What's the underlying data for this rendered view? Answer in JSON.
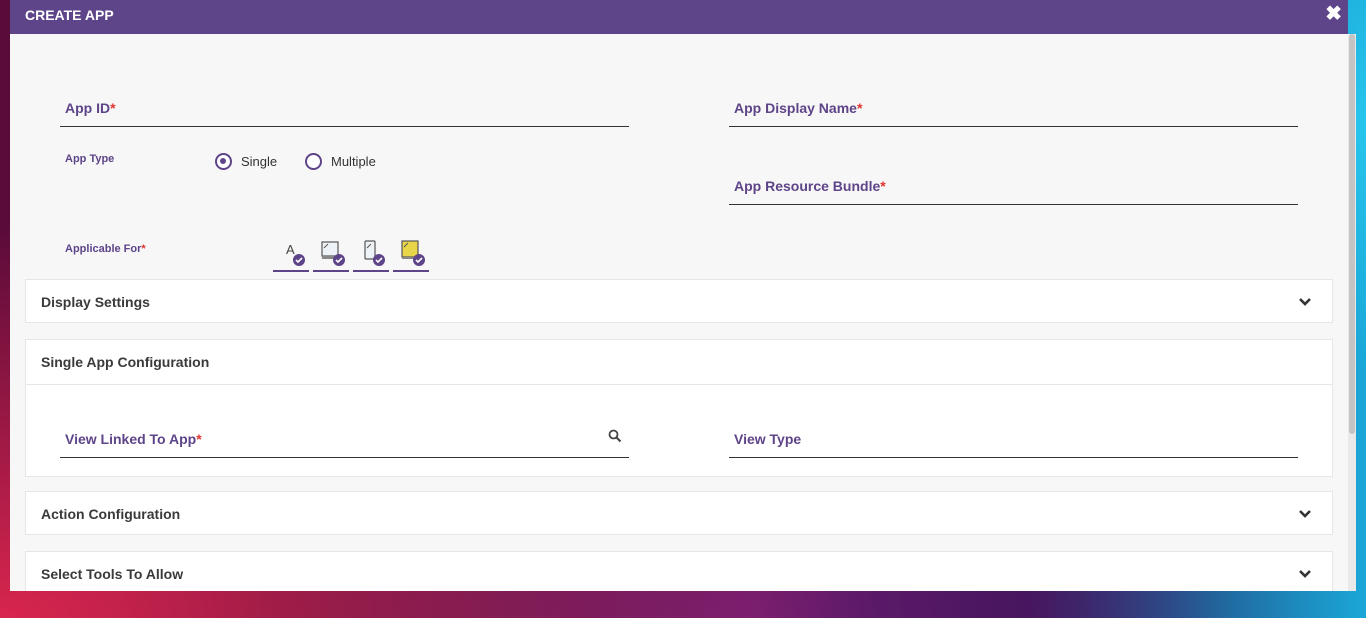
{
  "dialog": {
    "title": "CREATE APP",
    "close_icon": "close-icon"
  },
  "fields": {
    "app_id": {
      "label": "App ID",
      "required": "*",
      "value": ""
    },
    "app_display_name": {
      "label": "App Display Name",
      "required": "*",
      "value": ""
    },
    "app_resource_bundle": {
      "label": "App Resource Bundle",
      "required": "*",
      "value": ""
    }
  },
  "app_type": {
    "label": "App Type",
    "options": [
      {
        "label": "Single",
        "selected": true
      },
      {
        "label": "Multiple",
        "selected": false
      }
    ]
  },
  "applicable_for": {
    "label": "Applicable For",
    "required": "*",
    "devices": [
      {
        "icon": "accessibility-text-icon",
        "checked": true
      },
      {
        "icon": "desktop-icon",
        "checked": true
      },
      {
        "icon": "mobile-icon",
        "checked": true
      },
      {
        "icon": "tablet-icon",
        "checked": true
      }
    ]
  },
  "sections": {
    "display_settings": {
      "title": "Display Settings"
    },
    "single_app_configuration": {
      "title": "Single App Configuration",
      "view_linked_to_app": {
        "label": "View Linked To App",
        "required": "*",
        "value": ""
      },
      "view_type": {
        "label": "View Type",
        "value": ""
      }
    },
    "action_configuration": {
      "title": "Action Configuration"
    },
    "select_tools_to_allow": {
      "title": "Select Tools To Allow"
    }
  },
  "colors": {
    "accent": "#5e4488",
    "required": "#e0342f",
    "header_text": "#ffffff"
  }
}
